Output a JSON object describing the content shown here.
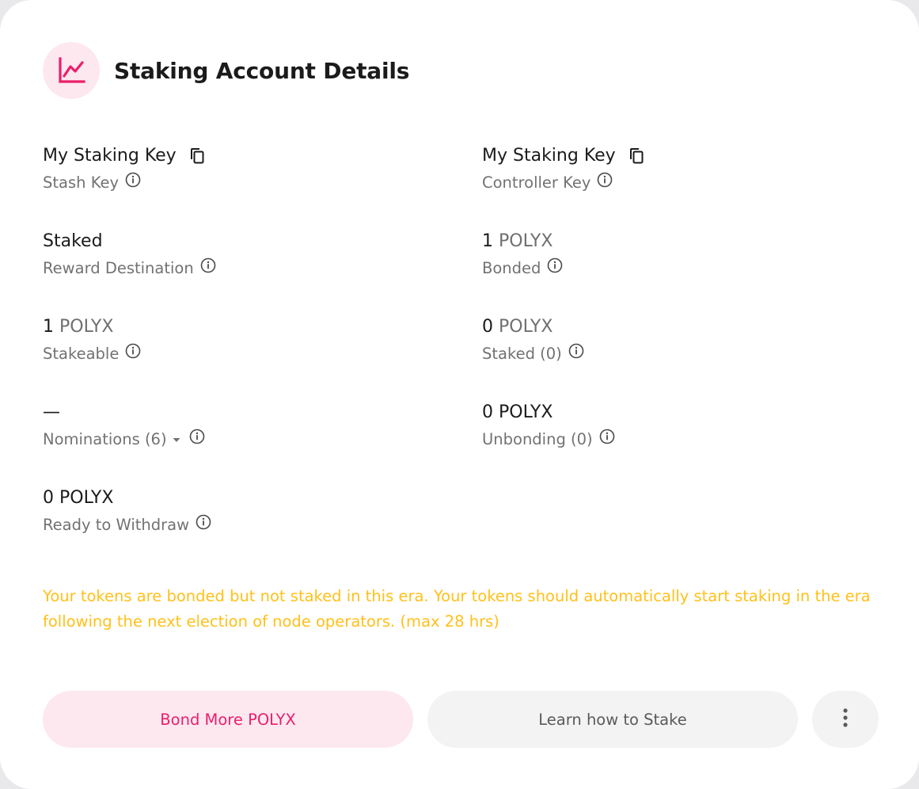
{
  "header": {
    "title": "Staking Account Details",
    "icon": "chart-line-icon"
  },
  "fields": {
    "stash": {
      "value": "My Staking Key",
      "label": "Stash Key"
    },
    "controller": {
      "value": "My Staking Key",
      "label": "Controller Key"
    },
    "reward_destination": {
      "value": "Staked",
      "label": "Reward Destination"
    },
    "bonded": {
      "amount": "1",
      "unit": "POLYX",
      "label": "Bonded"
    },
    "stakeable": {
      "amount": "1",
      "unit": "POLYX",
      "label": "Stakeable"
    },
    "staked": {
      "amount": "0",
      "unit": "POLYX",
      "label": "Staked (0)"
    },
    "nominations": {
      "value": "—",
      "label": "Nominations (6)"
    },
    "unbonding": {
      "amount": "0",
      "unit": "POLYX",
      "label": "Unbonding (0)"
    },
    "ready_to_withdraw": {
      "amount": "0",
      "unit": "POLYX",
      "label": "Ready to Withdraw"
    }
  },
  "notice": "Your tokens are bonded but not staked in this era. Your tokens should automatically start staking in the era following the next election of node operators. (max 28 hrs)",
  "actions": {
    "bond_more": "Bond More POLYX",
    "learn": "Learn how to Stake",
    "more_icon": "more-vertical-icon"
  },
  "colors": {
    "accent": "#ec1e6b",
    "accent_bg": "#fde8ef",
    "warning": "#ffc019",
    "muted": "#727272"
  }
}
